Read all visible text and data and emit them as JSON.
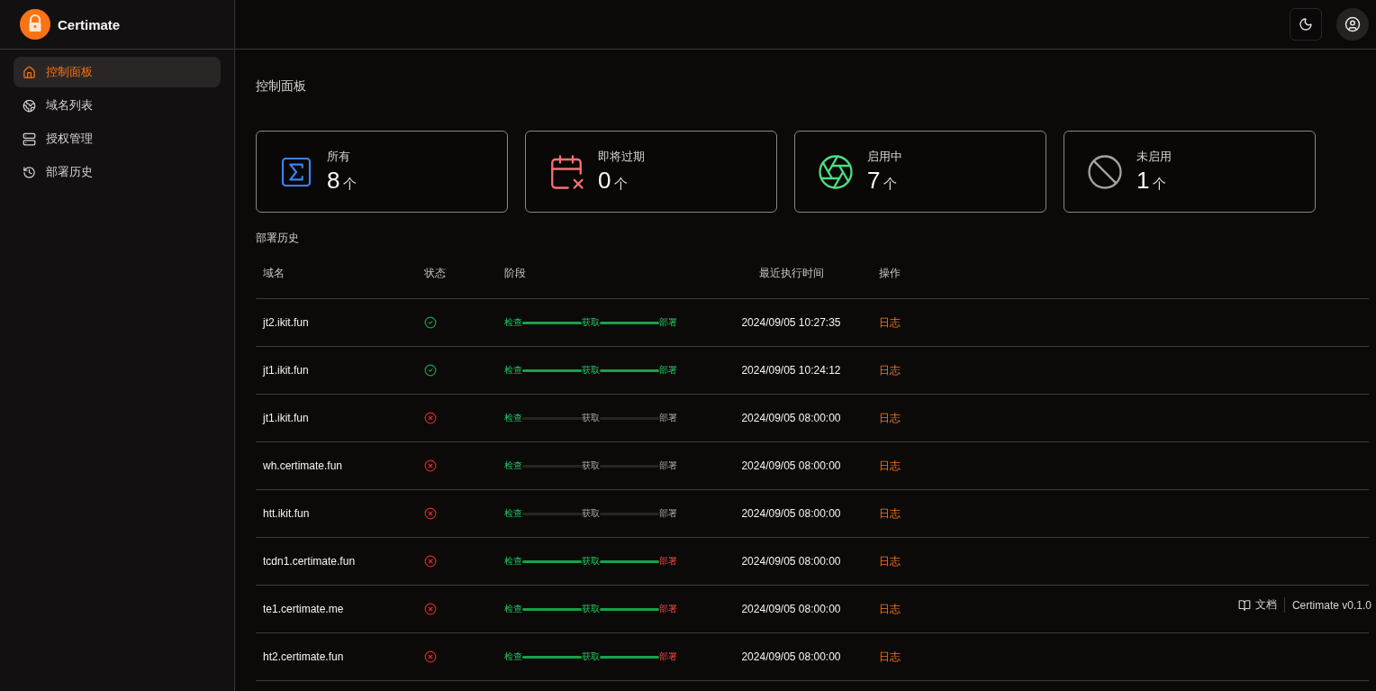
{
  "app": {
    "name": "Certimate"
  },
  "sidebar": {
    "items": [
      {
        "label": "控制面板",
        "selected": true
      },
      {
        "label": "域名列表",
        "selected": false
      },
      {
        "label": "授权管理",
        "selected": false
      },
      {
        "label": "部署历史",
        "selected": false
      }
    ]
  },
  "page_title": "控制面板",
  "stats": [
    {
      "label": "所有",
      "value": "8",
      "unit": "个",
      "kind": "all"
    },
    {
      "label": "即将过期",
      "value": "0",
      "unit": "个",
      "kind": "expiring"
    },
    {
      "label": "启用中",
      "value": "7",
      "unit": "个",
      "kind": "enabled"
    },
    {
      "label": "未启用",
      "value": "1",
      "unit": "个",
      "kind": "disabled"
    }
  ],
  "history": {
    "title": "部署历史",
    "columns": [
      "域名",
      "状态",
      "阶段",
      "最近执行时间",
      "操作"
    ],
    "rows": [
      {
        "domain": "jt2.ikit.fun",
        "succeeded": true,
        "stages": [
          {
            "label": "检查",
            "done": true,
            "failed": false
          },
          {
            "label": "获取",
            "done": true,
            "failed": false
          },
          {
            "label": "部署",
            "done": true,
            "failed": false
          }
        ],
        "time": "2024/09/05 10:27:35",
        "action": "日志"
      },
      {
        "domain": "jt1.ikit.fun",
        "succeeded": true,
        "stages": [
          {
            "label": "检查",
            "done": true,
            "failed": false
          },
          {
            "label": "获取",
            "done": true,
            "failed": false
          },
          {
            "label": "部署",
            "done": true,
            "failed": false
          }
        ],
        "time": "2024/09/05 10:24:12",
        "action": "日志"
      },
      {
        "domain": "jt1.ikit.fun",
        "succeeded": false,
        "stages": [
          {
            "label": "检查",
            "done": true,
            "failed": false
          },
          {
            "label": "获取",
            "done": false,
            "failed": false
          },
          {
            "label": "部署",
            "done": false,
            "failed": false
          }
        ],
        "time": "2024/09/05 08:00:00",
        "action": "日志"
      },
      {
        "domain": "wh.certimate.fun",
        "succeeded": false,
        "stages": [
          {
            "label": "检查",
            "done": true,
            "failed": false
          },
          {
            "label": "获取",
            "done": false,
            "failed": false
          },
          {
            "label": "部署",
            "done": false,
            "failed": false
          }
        ],
        "time": "2024/09/05 08:00:00",
        "action": "日志"
      },
      {
        "domain": "htt.ikit.fun",
        "succeeded": false,
        "stages": [
          {
            "label": "检查",
            "done": true,
            "failed": false
          },
          {
            "label": "获取",
            "done": false,
            "failed": false
          },
          {
            "label": "部署",
            "done": false,
            "failed": false
          }
        ],
        "time": "2024/09/05 08:00:00",
        "action": "日志"
      },
      {
        "domain": "tcdn1.certimate.fun",
        "succeeded": false,
        "stages": [
          {
            "label": "检查",
            "done": true,
            "failed": false
          },
          {
            "label": "获取",
            "done": true,
            "failed": false
          },
          {
            "label": "部署",
            "done": true,
            "failed": true
          }
        ],
        "time": "2024/09/05 08:00:00",
        "action": "日志"
      },
      {
        "domain": "te1.certimate.me",
        "succeeded": false,
        "stages": [
          {
            "label": "检查",
            "done": true,
            "failed": false
          },
          {
            "label": "获取",
            "done": true,
            "failed": false
          },
          {
            "label": "部署",
            "done": true,
            "failed": true
          }
        ],
        "time": "2024/09/05 08:00:00",
        "action": "日志"
      },
      {
        "domain": "ht2.certimate.fun",
        "succeeded": false,
        "stages": [
          {
            "label": "检查",
            "done": true,
            "failed": false
          },
          {
            "label": "获取",
            "done": true,
            "failed": false
          },
          {
            "label": "部署",
            "done": true,
            "failed": true
          }
        ],
        "time": "2024/09/05 08:00:00",
        "action": "日志"
      }
    ]
  },
  "footer": {
    "docs": "文档",
    "version": "Certimate v0.1.0"
  }
}
